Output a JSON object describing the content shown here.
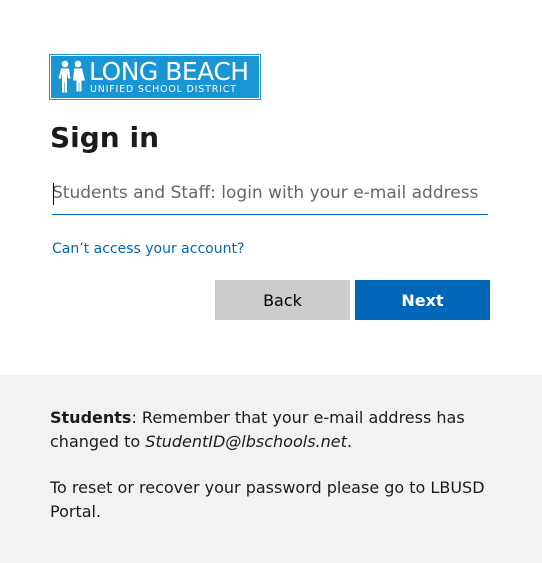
{
  "logo": {
    "title": "LONG BEACH",
    "subtitle": "UNIFIED SCHOOL DISTRICT",
    "icon": "school-children-icon",
    "color": "#1a95d3"
  },
  "heading": "Sign in",
  "email_input": {
    "value": "",
    "placeholder": "Students and Staff: login with your e-mail address"
  },
  "help_link": "Can’t access your account?",
  "buttons": {
    "back_label": "Back",
    "next_label": "Next"
  },
  "footer": {
    "note1_strong": "Students",
    "note1_text": ": Remember that your e-mail address has changed to ",
    "note1_em": "StudentID@lbschools.net",
    "note1_end": ".",
    "note2": "To reset or recover your password please go to LBUSD Portal."
  },
  "colors": {
    "accent": "#0067b8",
    "secondary_button": "#cccccc",
    "footer_bg": "#f2f2f2"
  }
}
